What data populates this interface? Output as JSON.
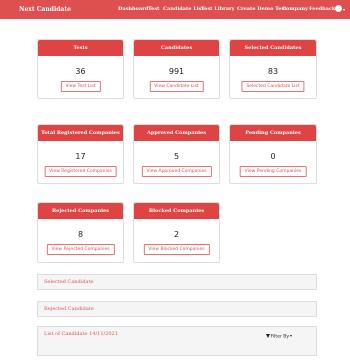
{
  "navbar": {
    "brand": "Next Candidate",
    "links": [
      "Dashboard",
      "Test",
      "Candidate List",
      "Test Library",
      "Create Demo Test",
      "Company",
      "Feedback"
    ],
    "user_caret": "▾",
    "color": "#de4f4f"
  },
  "cards": [
    {
      "title": "Tests",
      "count": "36",
      "button": "View Test List"
    },
    {
      "title": "Candidates",
      "count": "991",
      "button": "View Candidate List"
    },
    {
      "title": "Selected Candidates",
      "count": "83",
      "button": "Selected Candidate List"
    },
    {
      "title": "Total Registered Companies",
      "count": "17",
      "button": "View Registered Companies"
    },
    {
      "title": "Approved Companies",
      "count": "5",
      "button": "View Approved Companies"
    },
    {
      "title": "Pending Companies",
      "count": "0",
      "button": "View Pending Companies"
    },
    {
      "title": "Rejected Companies",
      "count": "8",
      "button": "View Rejected Companies"
    },
    {
      "title": "Blocked Companies",
      "count": "2",
      "button": "View Blocked Companies"
    }
  ],
  "panels": [
    {
      "title": "Selected Candidate"
    },
    {
      "title": "Rejected Candidate"
    },
    {
      "title": "List of Candidate 14/11/2021",
      "filter_label": "Filter By"
    }
  ],
  "colors": {
    "accent": "#de4444",
    "button_text": "#d9534f"
  }
}
